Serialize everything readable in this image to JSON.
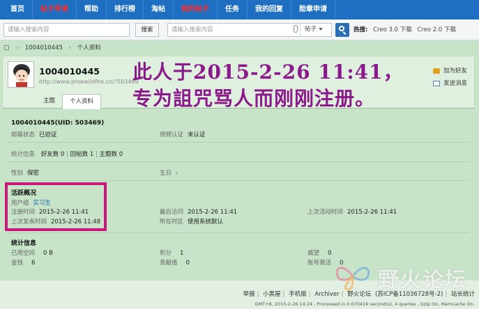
{
  "nav": {
    "items": [
      {
        "label": "首页",
        "highlight": false
      },
      {
        "label": "帖子导读",
        "highlight": true
      },
      {
        "label": "帮助",
        "highlight": false
      },
      {
        "label": "排行榜",
        "highlight": false
      },
      {
        "label": "淘帖",
        "highlight": false
      },
      {
        "label": "我的帖子",
        "highlight": true
      },
      {
        "label": "任务",
        "highlight": false
      },
      {
        "label": "我的回复",
        "highlight": false
      },
      {
        "label": "勋章申请",
        "highlight": false
      }
    ]
  },
  "search": {
    "left_placeholder": "请输入搜索内容",
    "left_button": "搜索",
    "main_placeholder": "请输入搜索内容",
    "scope": "帖子",
    "hot_label": "热搜:",
    "hot_links": [
      "Creo 3.0 下载",
      "Creo 2.0 下载"
    ]
  },
  "breadcrumb": {
    "items": [
      "1004010445",
      "个人资料"
    ]
  },
  "profile": {
    "username": "1004010445",
    "url": "http://www.proewildfire.cn/?503469",
    "tabs": [
      "主题",
      "个人资料"
    ],
    "actions": [
      "加为好友",
      "发送消息"
    ]
  },
  "overlay": {
    "line1": "此人于2015-2-26  11:41，",
    "line2": "专为詛咒骂人而刚刚注册。"
  },
  "info": {
    "uid_line": "1004010445(UID: 503469)",
    "email_label": "邮箱状态",
    "email_value": "已验证",
    "video_label": "视频认证",
    "video_value": "未认证",
    "stats_label": "统计信息",
    "stats": [
      "好友数 0",
      "回帖数 1",
      "主题数 0"
    ],
    "gender_label": "性别",
    "gender_value": "保密",
    "birthday_label": "生日",
    "birthday_value": "-",
    "activity_title": "活跃概况",
    "group_label": "用户组",
    "group_value": "实习生",
    "reg_label": "注册时间",
    "reg_value": "2015-2-26 11:41",
    "lastvisit_label": "最后访问",
    "lastvisit_value": "2015-2-26 11:41",
    "lastactive_label": "上次活动时间",
    "lastactive_value": "2015-2-26 11:41",
    "lastpost_label": "上次发表时间",
    "lastpost_value": "2015-2-26 11:48",
    "region_label": "所在时区",
    "region_value": "使用系统默认",
    "statistics_title": "统计信息",
    "space_label": "已用空间",
    "space_value": "0 B",
    "points_label": "积分",
    "points_value": "1",
    "prestige_label": "威望",
    "prestige_value": "0",
    "money_label": "金钱",
    "money_value": "6",
    "contrib_label": "贡献值",
    "contrib_value": "0",
    "activation_label": "账号激活",
    "activation_value": "0"
  },
  "footer": {
    "links": [
      "举报",
      "小黑屋",
      "手机版",
      "Archiver",
      "野火论坛",
      "(苏ICP备11036728号-2)",
      "站长统计"
    ],
    "meta": "GMT+8, 2015-2-26 14:24 , Processed in 0.070419 second(s), 4 queries , Gzip On, Memcache On."
  },
  "watermark": {
    "text": "野火论坛"
  },
  "colors": {
    "nav_bg": "#1e6fc1",
    "page_bg": "#c8e4c8",
    "overlay_text": "#8b1a8b",
    "highlight_box": "#c9177e",
    "link": "#1a64b0"
  }
}
